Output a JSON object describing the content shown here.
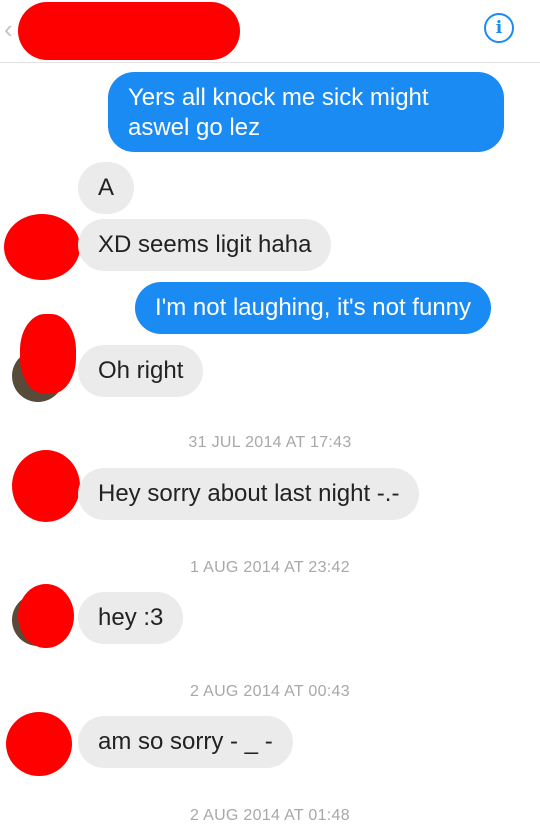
{
  "header": {
    "back_icon": "chevron-left-icon",
    "info_icon": "info-icon",
    "info_glyph": "i",
    "accent_color": "#1a8bf2"
  },
  "messages": [
    {
      "from": "me",
      "text_lines": [
        "Yers all knock me sick might",
        "aswel go lez"
      ]
    },
    {
      "from": "them",
      "text": "A"
    },
    {
      "from": "them",
      "text": "XD seems ligit haha"
    },
    {
      "from": "me",
      "text": "I'm not laughing, it's not funny"
    },
    {
      "from": "them",
      "text": "Oh right"
    },
    {
      "timestamp": "31 JUL 2014 AT 17:43"
    },
    {
      "from": "them",
      "text": "Hey sorry about last night -.-"
    },
    {
      "timestamp": "1 AUG 2014 AT 23:42"
    },
    {
      "from": "them",
      "text": "hey :3"
    },
    {
      "timestamp": "2 AUG 2014 AT 00:43"
    },
    {
      "from": "them",
      "text": "am so sorry - _ -"
    },
    {
      "timestamp": "2 AUG 2014 AT 01:48"
    }
  ],
  "colors": {
    "outgoing_bubble": "#1a8bf2",
    "incoming_bubble": "#ebebeb",
    "redaction": "#ff0000"
  }
}
